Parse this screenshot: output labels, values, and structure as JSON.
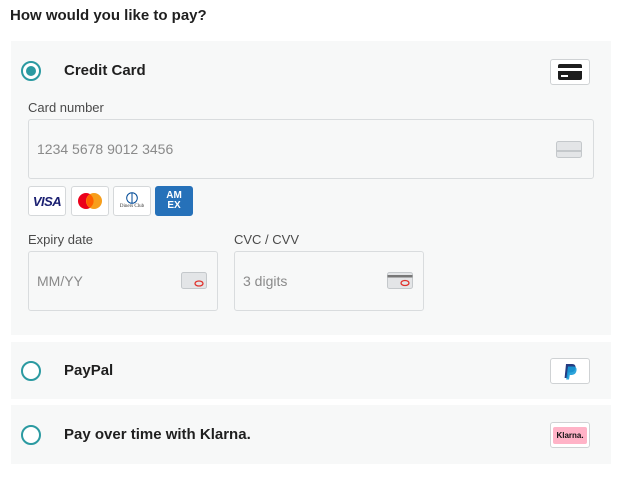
{
  "heading": "How would you like to pay?",
  "methods": {
    "credit_card": {
      "label": "Credit Card",
      "selected": true,
      "icon": "credit-card-icon",
      "card_number": {
        "label": "Card number",
        "placeholder": "1234 5678 9012 3456"
      },
      "expiry": {
        "label": "Expiry date",
        "placeholder": "MM/YY"
      },
      "cvc": {
        "label": "CVC / CVV",
        "placeholder": "3 digits"
      },
      "logos": [
        {
          "name": "visa-logo",
          "text": "VISA"
        },
        {
          "name": "mastercard-logo",
          "text": ""
        },
        {
          "name": "diners-club-logo",
          "text": "Diners Club"
        },
        {
          "name": "amex-logo",
          "text": "AM EX"
        }
      ]
    },
    "paypal": {
      "label": "PayPal",
      "selected": false,
      "icon": "paypal-icon"
    },
    "klarna": {
      "label": "Pay over time with Klarna.",
      "selected": false,
      "icon": "klarna-icon",
      "badge_text": "Klarna."
    }
  },
  "colors": {
    "accent": "#2b9aa1",
    "panel_bg": "#f7f8f8",
    "visa_blue": "#1a1f71",
    "amex_blue": "#2671b9",
    "klarna_pink": "#ffb3c7"
  }
}
